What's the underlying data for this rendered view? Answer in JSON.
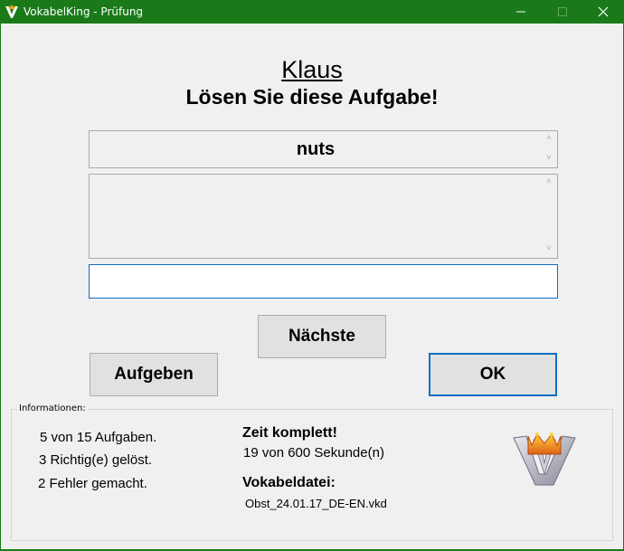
{
  "window": {
    "title": "VokabelKing - Prüfung",
    "title_bar_color": "#1a7a1a"
  },
  "header": {
    "user_name": "Klaus",
    "instruction": "Lösen Sie diese Aufgabe!"
  },
  "question": {
    "word": "nuts",
    "answer_display": "",
    "input_value": "",
    "input_placeholder": ""
  },
  "buttons": {
    "next": "Nächste",
    "give_up": "Aufgeben",
    "ok": "OK"
  },
  "info": {
    "legend": "Informationen:",
    "progress": "5 von 15 Aufgaben.",
    "correct": "3 Richtig(e) gelöst.",
    "errors": "2 Fehler gemacht.",
    "time_label": "Zeit komplett!",
    "time_value": "19 von 600 Sekunde(n)",
    "file_label": "Vokabeldatei:",
    "file_name": "Obst_24.01.17_DE-EN.vkd"
  },
  "icons": {
    "app": "vokabelking-logo-icon",
    "minimize": "minimize-icon",
    "maximize": "maximize-icon",
    "close": "close-icon"
  }
}
